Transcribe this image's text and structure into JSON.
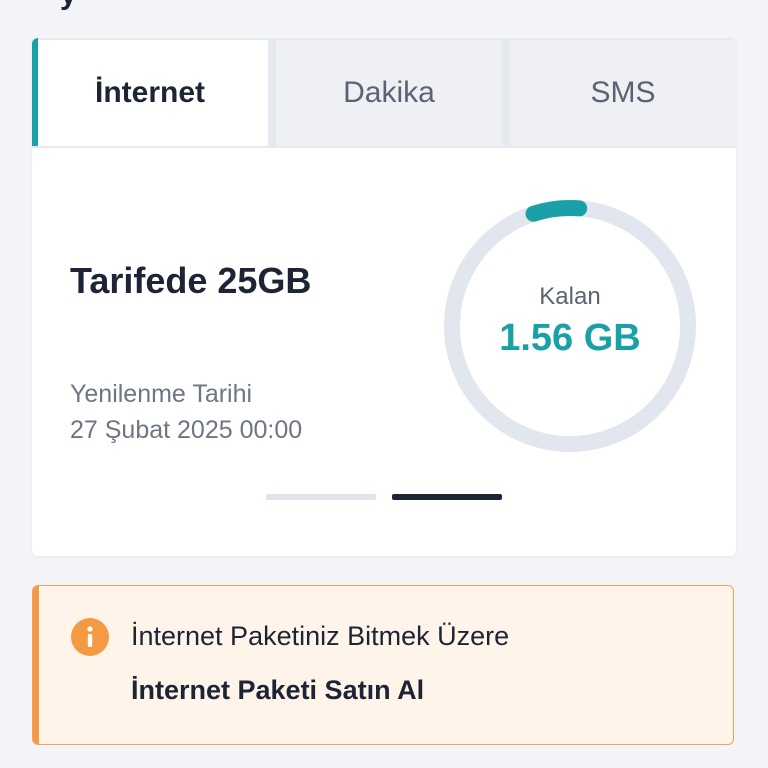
{
  "tabs": [
    {
      "label": "İnternet",
      "active": true
    },
    {
      "label": "Dakika",
      "active": false
    },
    {
      "label": "SMS",
      "active": false
    }
  ],
  "package": {
    "title": "Tarifede 25GB",
    "renewal_label": "Yenilenme Tarihi",
    "renewal_date": "27 Şubat 2025 00:00"
  },
  "gauge": {
    "remaining_label": "Kalan",
    "remaining_value": "1.56 GB",
    "remaining_fraction": 0.0624
  },
  "pager": {
    "total": 2,
    "active_index": 1
  },
  "alert": {
    "message": "İnternet Paketiniz Bitmek Üzere",
    "link_label": "İnternet Paketi Satın Al",
    "icon": "info-icon"
  },
  "colors": {
    "accent": "#1aa1a8",
    "warning": "#f39a43",
    "text_dark": "#1c2435",
    "track": "#e2e6ee"
  }
}
